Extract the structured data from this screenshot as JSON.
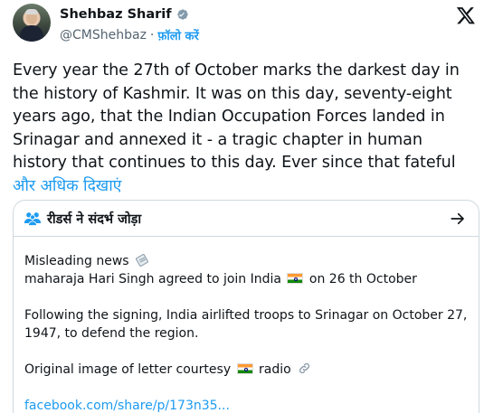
{
  "author": {
    "name": "Shehbaz Sharif",
    "handle": "@CMShehbaz",
    "separator": "·",
    "follow_label": "फ़ॉलो करें"
  },
  "tweet": {
    "text": "Every year the 27th of October marks the darkest day in the history of Kashmir. It was on this day, seventy-eight years ago, that the Indian Occupation Forces landed in Srinagar and annexed it - a tragic chapter in human history that continues to this day. Ever since that fateful",
    "show_more": "और अधिक दिखाएं"
  },
  "community_note": {
    "title": "रीडर्स ने संदर्भ जोड़ा",
    "line1": "Misleading news",
    "line2_before": "maharaja Hari Singh agreed to join India",
    "line2_after": "on 26 th October",
    "para2": "Following the signing, India airlifted troops to Srinagar on October 27, 1947, to defend the region.",
    "para3_before": "Original image of letter courtesy",
    "para3_after": "radio",
    "link": "facebook.com/share/p/173n35..."
  },
  "icons": {
    "verified": "verified-badge-icon",
    "x_logo": "x-logo-icon",
    "people": "people-icon",
    "arrow": "arrow-right-icon",
    "flag": "india-flag-icon",
    "news": "newspaper-icon",
    "link": "link-icon"
  },
  "colors": {
    "accent": "#1d9bf0",
    "text": "#0f1419",
    "muted": "#536471",
    "border": "#cfd9de"
  }
}
